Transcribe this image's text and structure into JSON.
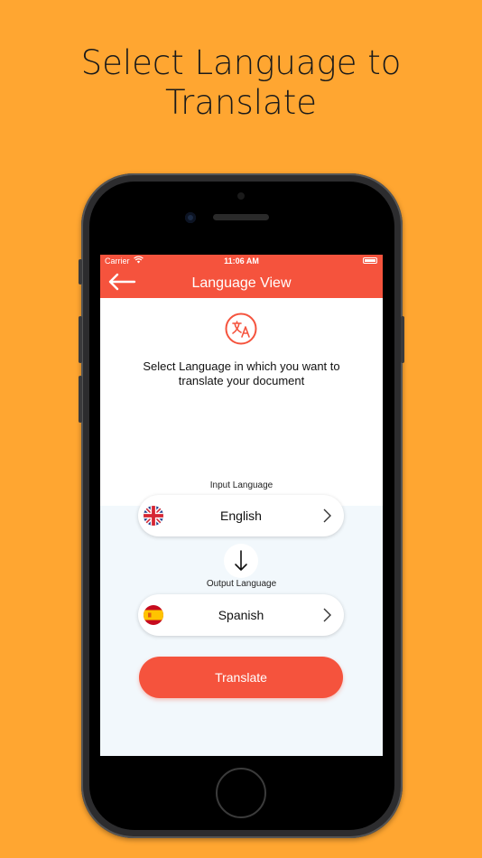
{
  "headline": {
    "line1": "Select Language to",
    "line2": "Translate"
  },
  "status_bar": {
    "carrier": "Carrier",
    "time": "11:06 AM"
  },
  "nav": {
    "title": "Language View",
    "back_icon": "arrow-left-icon"
  },
  "content": {
    "instruction_line1": "Select Language in which you want to",
    "instruction_line2": "translate your document",
    "translate_icon": "translate-icon"
  },
  "input_language": {
    "label": "Input Language",
    "value": "English",
    "flag": "uk-flag-icon"
  },
  "output_language": {
    "label": "Output Language",
    "value": "Spanish",
    "flag": "spain-flag-icon"
  },
  "swap_icon": "arrow-down-icon",
  "translate_button": {
    "label": "Translate"
  },
  "colors": {
    "background": "#FFA631",
    "accent": "#F5533D",
    "panel": "#F2F8FC"
  }
}
